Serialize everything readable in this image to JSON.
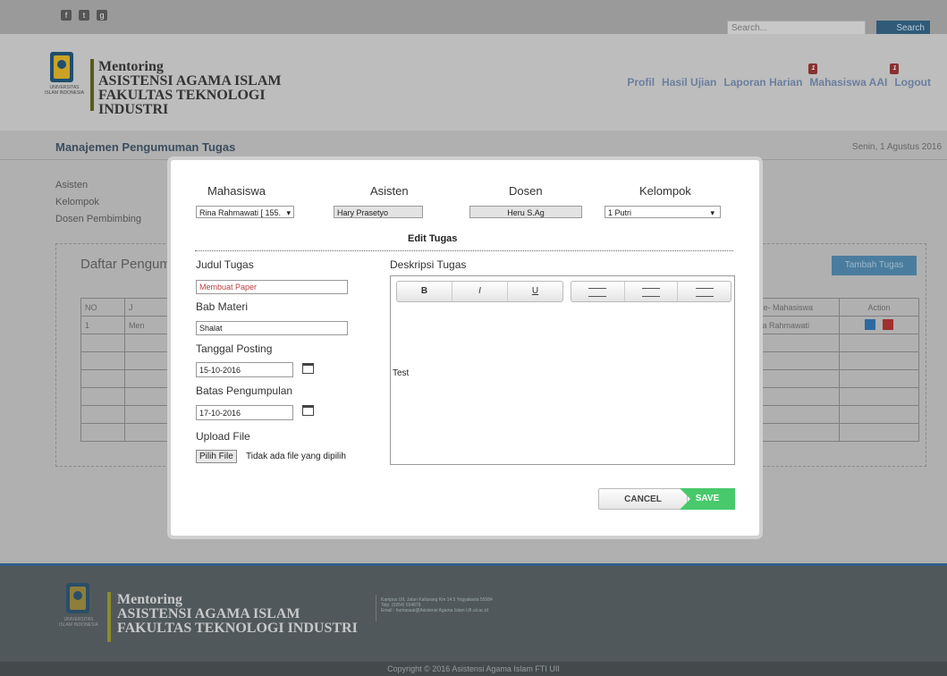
{
  "header": {
    "social": [
      "f",
      "t",
      "g"
    ],
    "search_placeholder": "Search...",
    "search_button": "Search",
    "logo_title": [
      "Mentoring",
      "ASISTENSI AGAMA ISLAM",
      "FAKULTAS TEKNOLOGI",
      "INDUSTRI"
    ],
    "logo_university": "UNIVERSITAS ISLAM INDONESIA",
    "nav": [
      {
        "label": "Profil",
        "badge": ""
      },
      {
        "label": "Hasil Ujian",
        "badge": ""
      },
      {
        "label": "Laporan Harian",
        "badge": "1"
      },
      {
        "label": "Mahasiswa AAI",
        "badge": "1"
      },
      {
        "label": "Logout",
        "badge": ""
      }
    ]
  },
  "page": {
    "title": "Manajemen Pengumuman Tugas",
    "date": "Senin, 1 Agustus 2016",
    "info": [
      "Asisten",
      "Kelompok",
      "Dosen Pembimbing"
    ],
    "panel_title": "Daftar Pengumuman",
    "tambah_button": "Tambah Tugas",
    "table": {
      "headers": [
        "NO",
        "J",
        "",
        "m ke- Mahasiswa",
        "Action"
      ],
      "row": [
        "1",
        "Men",
        "",
        "Rina Rahmawati",
        ""
      ]
    }
  },
  "modal": {
    "labels": {
      "mahasiswa": "Mahasiswa",
      "asisten": "Asisten",
      "dosen": "Dosen",
      "kelompok": "Kelompok"
    },
    "mahasiswa_value": "Rina Rahmawati [ 155.",
    "asisten_value": "Hary Prasetyo",
    "dosen_value": "Heru S.Ag",
    "kelompok_value": "1 Putri",
    "edit_title": "Edit Tugas",
    "judul_label": "Judul Tugas",
    "judul_value": "Membuat Paper",
    "bab_label": "Bab Materi",
    "bab_value": "Shalat",
    "tanggal_label": "Tanggal Posting",
    "tanggal_value": "15-10-2016",
    "batas_label": "Batas Pengumpulan",
    "batas_value": "17-10-2016",
    "upload_label": "Upload File",
    "file_button": "Pilih File",
    "file_status": "Tidak ada file yang dipilih",
    "deskripsi_label": "Deskripsi Tugas",
    "toolbar": {
      "bold": "B",
      "italic": "I",
      "underline": "U"
    },
    "deskripsi_value": "Test",
    "cancel": "CANCEL",
    "save": "SAVE"
  },
  "footer": {
    "title": [
      "Mentoring",
      "ASISTENSI AGAMA ISLAM",
      "FAKULTAS TEKNOLOGI INDUSTRI"
    ],
    "university": "UNIVERSITAS ISLAM INDONESIA",
    "address": [
      "Kampus UII, Jalan Kaliurang Km 14.5 Yogyakarta 55584",
      "Telp. (0264) 554878",
      "Email : humasaai@Asistensi Agama Islam UII.uii.ac.id"
    ],
    "copyright": "Copyright © 2016 Asistensi Agama Islam FTI UII"
  }
}
